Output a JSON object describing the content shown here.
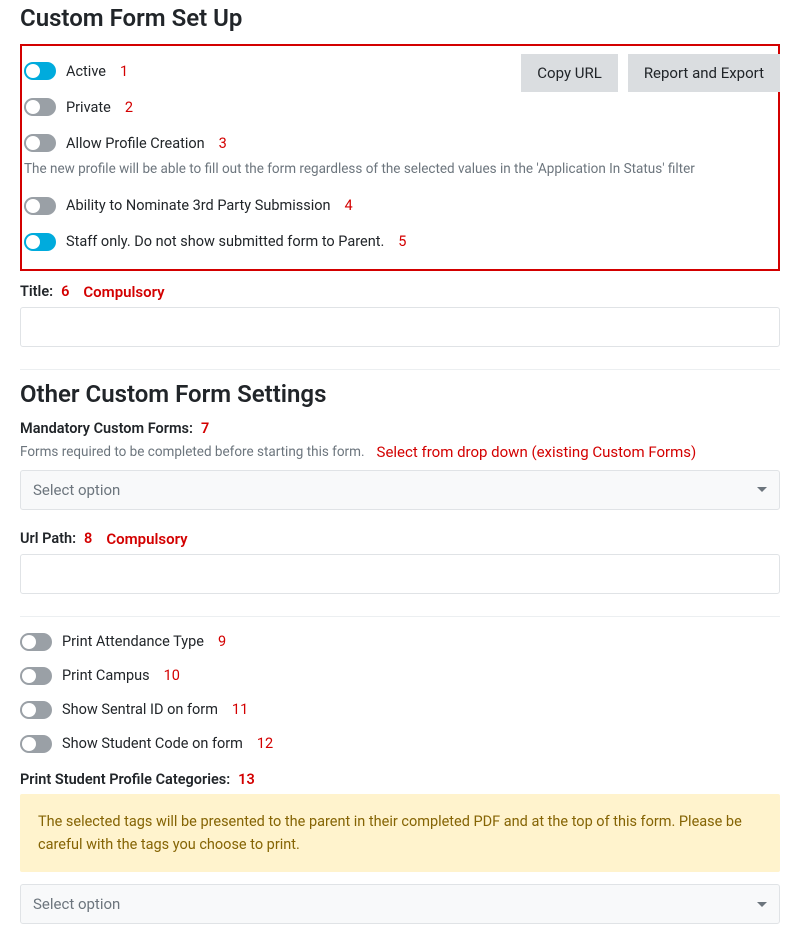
{
  "heading": "Custom Form Set Up",
  "buttons": {
    "copy_url": "Copy URL",
    "report_export": "Report and Export"
  },
  "toggles": {
    "active": {
      "label": "Active",
      "on": true,
      "annot": "1"
    },
    "private": {
      "label": "Private",
      "on": false,
      "annot": "2"
    },
    "allow_profile_creation": {
      "label": "Allow Profile Creation",
      "on": false,
      "annot": "3",
      "help": "The new profile will be able to fill out the form regardless of the selected values in the 'Application In Status' filter"
    },
    "nominate_3rd": {
      "label": "Ability to Nominate 3rd Party Submission",
      "on": false,
      "annot": "4"
    },
    "staff_only": {
      "label": "Staff only. Do not show submitted form to Parent.",
      "on": true,
      "annot": "5"
    }
  },
  "title_field": {
    "label": "Title:",
    "annot": "6",
    "annot_text": "Compulsory",
    "value": ""
  },
  "section2_heading": "Other Custom Form Settings",
  "mandatory_forms": {
    "label": "Mandatory Custom Forms:",
    "annot": "7",
    "help": "Forms required to be completed before starting this form.",
    "annot_text": "Select from drop down (existing Custom Forms)",
    "placeholder": "Select option"
  },
  "url_path": {
    "label": "Url Path:",
    "annot": "8",
    "annot_text": "Compulsory",
    "value": ""
  },
  "toggles2": {
    "print_attendance": {
      "label": "Print Attendance Type",
      "on": false,
      "annot": "9"
    },
    "print_campus": {
      "label": "Print Campus",
      "on": false,
      "annot": "10"
    },
    "show_sentral": {
      "label": "Show Sentral ID on form",
      "on": false,
      "annot": "11"
    },
    "show_student_code": {
      "label": "Show Student Code on form",
      "on": false,
      "annot": "12"
    }
  },
  "print_categories": {
    "label": "Print Student Profile Categories:",
    "annot": "13",
    "banner": "The selected tags will be presented to the parent in their completed PDF and at the top of this form. Please be careful with the tags you choose to print.",
    "placeholder": "Select option"
  }
}
